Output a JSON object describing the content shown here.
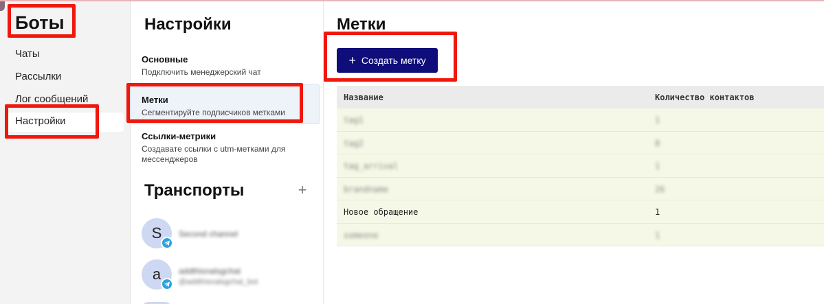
{
  "nav": {
    "title": "Боты",
    "items": [
      {
        "label": "Чаты"
      },
      {
        "label": "Рассылки"
      },
      {
        "label": "Лог сообщений"
      },
      {
        "label": "Настройки",
        "active": true
      }
    ]
  },
  "settings": {
    "title": "Настройки",
    "items": [
      {
        "title": "Основные",
        "desc": "Подключить менеджерский чат"
      },
      {
        "title": "Метки",
        "desc": "Сегментируйте подписчиков метками",
        "active": true
      },
      {
        "title": "Ссылки-метрики",
        "desc": "Создавате ссылки с utm-метками для мессенджеров"
      }
    ],
    "transports_title": "Транспорты",
    "add_icon": "plus-icon",
    "transports": [
      {
        "avatar_letter": "S",
        "name": "Second channel",
        "sub": "",
        "badge_icon": "telegram-icon"
      },
      {
        "avatar_letter": "a",
        "name": "addthisnalsgchat",
        "sub": "@addthisnalsgchat_bot",
        "badge_icon": "telegram-icon"
      }
    ]
  },
  "main": {
    "title": "Метки",
    "create_button_label": "Создать метку",
    "table": {
      "columns": [
        "Название",
        "Количество  контактов"
      ],
      "rows": [
        {
          "name": "tag1",
          "count": "1",
          "blurred": true
        },
        {
          "name": "tag2",
          "count": "8",
          "blurred": true
        },
        {
          "name": "tag_arrival",
          "count": "1",
          "blurred": true
        },
        {
          "name": "brandname",
          "count": "26",
          "blurred": true
        },
        {
          "name": "Новое обращение",
          "count": "1",
          "blurred": false
        },
        {
          "name": "someone",
          "count": "1",
          "blurred": true
        }
      ]
    }
  },
  "colors": {
    "accent": "#0f0d7a",
    "highlight": "#f0170c",
    "row_bg": "#f5f8e6",
    "telegram": "#2aa3e0"
  }
}
